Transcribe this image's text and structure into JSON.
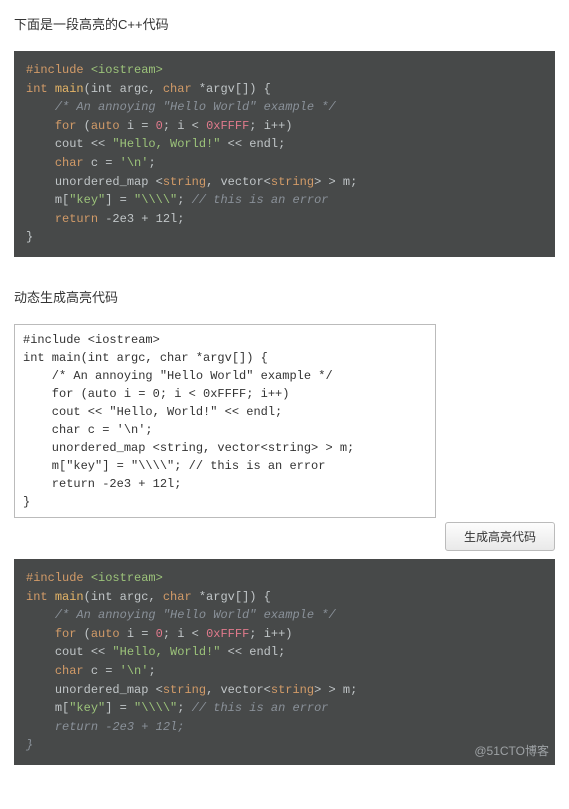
{
  "heading1": "下面是一段高亮的C++代码",
  "heading2": "动态生成高亮代码",
  "button_label": "生成高亮代码",
  "watermark": "@51CTO博客",
  "code": {
    "include": "#include",
    "iostream": "<iostream>",
    "int": "int",
    "main": "main",
    "sig_open": "(",
    "argc": "int argc, ",
    "char": "char",
    "argv": " *argv[]",
    "sig_close": ") {",
    "comment1": "/* An annoying \"Hello World\" example */",
    "for": "for",
    "for_open": " (",
    "auto": "auto",
    "for_body1": " i = ",
    "zero": "0",
    "for_body2": "; i < ",
    "hex": "0xFFFF",
    "for_body3": "; i++)",
    "cout": "cout << ",
    "hello": "\"Hello, World!\"",
    "endl": " << endl;",
    "char_decl": "char",
    "char_body": " c = ",
    "char_lit": "'\\n'",
    "semi": ";",
    "umap": "unordered_map <",
    "string1": "string",
    "umap_mid": ", vector<",
    "string2": "string",
    "umap_end": "> > m;",
    "mline1": "m[",
    "key": "\"key\"",
    "mline2": "] = ",
    "slashes": "\"\\\\\\\\\"",
    "mline3": "; ",
    "comment2": "// this is an error",
    "return": "return",
    "ret_body": " -2e3 + 12l;",
    "close": "}"
  },
  "plain_lines": [
    "#include <iostream>",
    "int main(int argc, char *argv[]) {",
    "    /* An annoying \"Hello World\" example */",
    "    for (auto i = 0; i < 0xFFFF; i++)",
    "    cout << \"Hello, World!\" << endl;",
    "    char c = '\\n';",
    "    unordered_map <string, vector<string> > m;",
    "    m[\"key\"] = \"\\\\\\\\\"; // this is an error",
    "    return -2e3 + 12l;",
    "}"
  ]
}
